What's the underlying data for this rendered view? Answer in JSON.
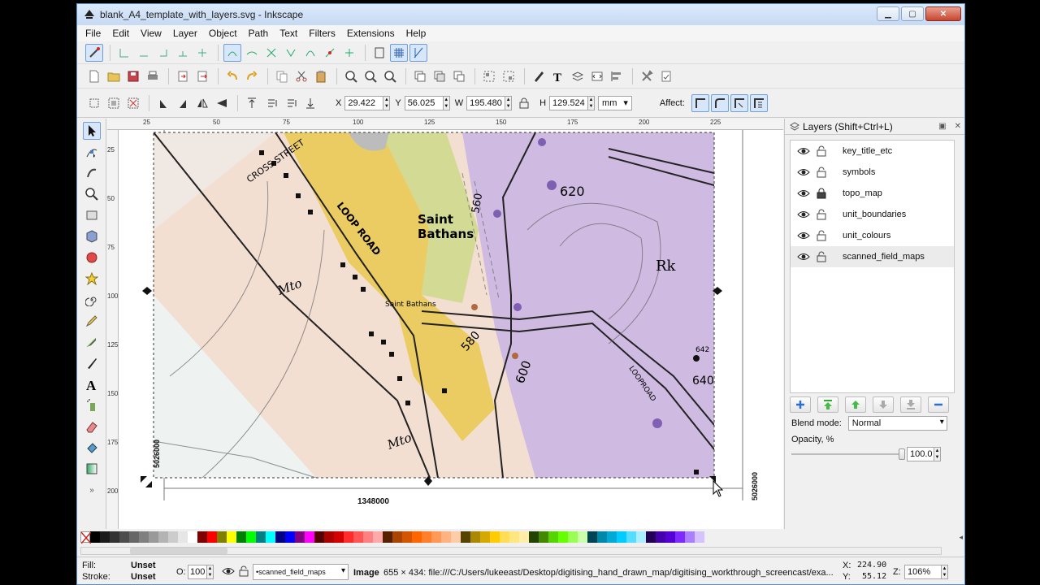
{
  "window": {
    "title": "blank_A4_template_with_layers.svg - Inkscape"
  },
  "menu": [
    "File",
    "Edit",
    "View",
    "Layer",
    "Object",
    "Path",
    "Text",
    "Filters",
    "Extensions",
    "Help"
  ],
  "controls": {
    "x_label": "X",
    "x": "29.422",
    "y_label": "Y",
    "y": "56.025",
    "w_label": "W",
    "w": "195.480",
    "h_label": "H",
    "h": "129.524",
    "unit": "mm",
    "affect_label": "Affect:"
  },
  "rulers": {
    "h_ticks": [
      "25",
      "50",
      "75",
      "100",
      "125",
      "150",
      "175",
      "200",
      "225"
    ],
    "v_ticks": [
      "25",
      "50",
      "75",
      "100",
      "125",
      "150",
      "175",
      "200"
    ]
  },
  "map_labels": {
    "cross_street": "CROSS STREET",
    "loop_road": "LOOP ROAD",
    "saint_bathans_big": "Saint\nBathans",
    "saint_bathans_small": "Saint Bathans",
    "c620": "620",
    "c560": "560",
    "c580": "580",
    "c600": "600",
    "c640": "640",
    "rk": "Rk",
    "mto1": "Mto",
    "mto2": "Mto",
    "loop_road2": "LOOPROAD",
    "c642": "642",
    "gridref_left": "5026000",
    "gridref_bottom": "1348000",
    "gridref_right": "5026000"
  },
  "layers_panel": {
    "title": "Layers (Shift+Ctrl+L)",
    "layers": [
      {
        "name": "key_title_etc",
        "locked": false
      },
      {
        "name": "symbols",
        "locked": false
      },
      {
        "name": "topo_map",
        "locked": true
      },
      {
        "name": "unit_boundaries",
        "locked": false
      },
      {
        "name": "unit_colours",
        "locked": false
      },
      {
        "name": "scanned_field_maps",
        "locked": false
      }
    ],
    "blend_mode_label": "Blend mode:",
    "blend_mode": "Normal",
    "opacity_label": "Opacity, %",
    "opacity": "100.0",
    "opacity_fraction": 1.0
  },
  "status": {
    "fill_label": "Fill:",
    "fill": "Unset",
    "stroke_label": "Stroke:",
    "stroke": "Unset",
    "o_label": "O:",
    "o_value": "100",
    "current_layer": "•scanned_field_maps",
    "message_bold": "Image",
    "message": "655 × 434: file:///C:/Users/lukeeast/Desktop/digitising_hand_drawn_map/digitising_workthrough_screencast/exa...",
    "x_label": "X:",
    "x": "224.90",
    "y_label": "Y:",
    "y": "55.12",
    "z_label": "Z:",
    "zoom": "106%"
  },
  "colors": {
    "accent": "#6f9fd8",
    "map_pink": "#f3dfd2",
    "map_yellow": "#e8c53c",
    "map_green": "#cbd98a",
    "map_purple": "#c8b4e4"
  },
  "palette": [
    "#000000",
    "#1a1a1a",
    "#333333",
    "#4d4d4d",
    "#666666",
    "#808080",
    "#999999",
    "#b3b3b3",
    "#cccccc",
    "#e6e6e6",
    "#ffffff",
    "#800000",
    "#ff0000",
    "#808000",
    "#ffff00",
    "#008000",
    "#00ff00",
    "#008080",
    "#00ffff",
    "#000080",
    "#0000ff",
    "#800080",
    "#ff00ff",
    "#550000",
    "#aa0000",
    "#d40000",
    "#ff2a2a",
    "#ff5555",
    "#ff8080",
    "#ffaaaa",
    "#552200",
    "#aa4400",
    "#d45500",
    "#ff6600",
    "#ff7f2a",
    "#ff9955",
    "#ffb380",
    "#ffccaa",
    "#554400",
    "#aa8800",
    "#d4aa00",
    "#ffcc00",
    "#ffdd55",
    "#ffe680",
    "#ffeeaa",
    "#224400",
    "#448800",
    "#55d400",
    "#66ff00",
    "#99ff55",
    "#ccffaa",
    "#004455",
    "#0088aa",
    "#00aad4",
    "#00ccff",
    "#55ddff",
    "#aaeeff",
    "#220055",
    "#4400aa",
    "#5500d4",
    "#7f2aff",
    "#aa80ff",
    "#d5c2ff"
  ]
}
